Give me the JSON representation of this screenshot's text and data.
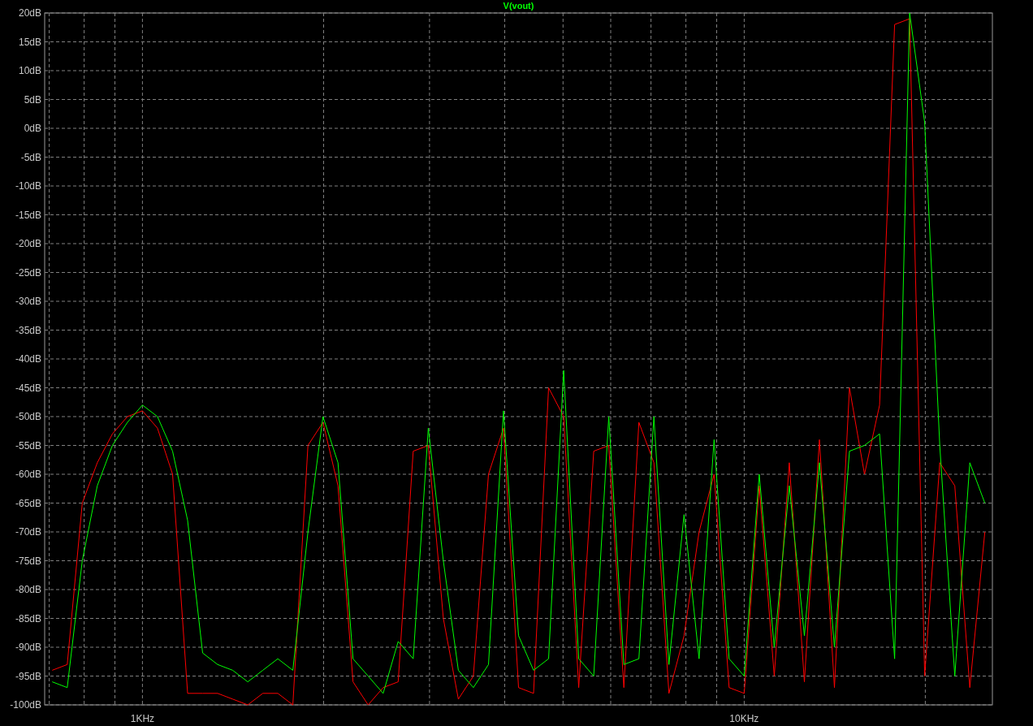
{
  "chart_data": {
    "type": "line",
    "title": "V(vout)",
    "categories": [
      null,
      null,
      null,
      null,
      null,
      null,
      "1KHz",
      null,
      null,
      null,
      null,
      null,
      null,
      null,
      null,
      null,
      null,
      null,
      null,
      null,
      null,
      null,
      null,
      null,
      null,
      null,
      null,
      null,
      null,
      null,
      null,
      null,
      null,
      null,
      null,
      null,
      null,
      null,
      null,
      null,
      null,
      null,
      null,
      null,
      null,
      null,
      "10KHz",
      null,
      null,
      null,
      null,
      null,
      null,
      null,
      null,
      null,
      null,
      null,
      null,
      null,
      null,
      null,
      null
    ],
    "series": [
      {
        "color": "#00ff00",
        "values": [
          -96,
          -97,
          -75,
          -62,
          -55,
          -51,
          -48,
          -50,
          -56,
          -68,
          -91,
          -93,
          -94,
          -96,
          -94,
          -92,
          -94,
          -70,
          -50,
          -58,
          -92,
          -95,
          -98,
          -89,
          -92,
          -52,
          -75,
          -94,
          -97,
          -93,
          -49,
          -88,
          -94,
          -92,
          -42,
          -92,
          -95,
          -50,
          -93,
          -92,
          -50,
          -93,
          -67,
          -92,
          -54,
          -92,
          -95,
          -60,
          -90,
          -62,
          -88,
          -58,
          -90,
          -56,
          -55,
          -53,
          -92,
          20,
          1,
          -55,
          -95,
          -58,
          -65
        ]
      },
      {
        "color": "#ff0000",
        "values": [
          -94,
          -93,
          -65,
          -58,
          -53,
          -50,
          -49,
          -52,
          -60,
          -98,
          -98,
          -98,
          -99,
          -100,
          -98,
          -98,
          -100,
          -55,
          -51,
          -62,
          -96,
          -100,
          -97,
          -96,
          -56,
          -55,
          -85,
          -99,
          -95,
          -60,
          -52,
          -97,
          -98,
          -45,
          -50,
          -97,
          -56,
          -55,
          -97,
          -51,
          -58,
          -98,
          -88,
          -70,
          -60,
          -97,
          -98,
          -62,
          -95,
          -58,
          -96,
          -54,
          -97,
          -45,
          -60,
          -48,
          18,
          19,
          -95,
          -58,
          -62,
          -97,
          -70
        ]
      }
    ],
    "ylim": [
      -100,
      20
    ],
    "grid": true,
    "yticks": [
      {
        "value": 20,
        "label": "20dB"
      },
      {
        "value": 15,
        "label": "15dB"
      },
      {
        "value": 10,
        "label": "10dB"
      },
      {
        "value": 5,
        "label": "5dB"
      },
      {
        "value": 0,
        "label": "0dB"
      },
      {
        "value": -5,
        "label": "-5dB"
      },
      {
        "value": -10,
        "label": "-10dB"
      },
      {
        "value": -15,
        "label": "-15dB"
      },
      {
        "value": -20,
        "label": "-20dB"
      },
      {
        "value": -25,
        "label": "-25dB"
      },
      {
        "value": -30,
        "label": "-30dB"
      },
      {
        "value": -35,
        "label": "-35dB"
      },
      {
        "value": -40,
        "label": "-40dB"
      },
      {
        "value": -45,
        "label": "-45dB"
      },
      {
        "value": -50,
        "label": "-50dB"
      },
      {
        "value": -55,
        "label": "-55dB"
      },
      {
        "value": -60,
        "label": "-60dB"
      },
      {
        "value": -65,
        "label": "-65dB"
      },
      {
        "value": -70,
        "label": "-70dB"
      },
      {
        "value": -75,
        "label": "-75dB"
      },
      {
        "value": -80,
        "label": "-80dB"
      },
      {
        "value": -85,
        "label": "-85dB"
      },
      {
        "value": -90,
        "label": "-90dB"
      },
      {
        "value": -95,
        "label": "-95dB"
      },
      {
        "value": -100,
        "label": "-100dB"
      }
    ]
  }
}
